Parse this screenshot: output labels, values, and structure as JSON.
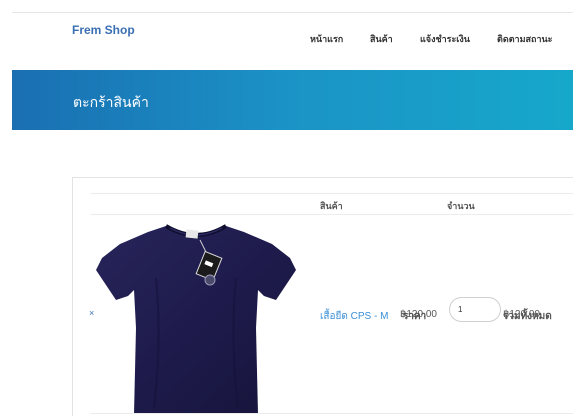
{
  "header": {
    "brand": "Frem Shop",
    "nav": [
      "หน้าแรก",
      "สินค้า",
      "แจ้งชำระเงิน",
      "ติดตามสถานะ"
    ]
  },
  "banner": {
    "title": "ตะกร้าสินค้า",
    "colors": [
      "#1a6fb2",
      "#16a8cb"
    ]
  },
  "cart": {
    "headers": {
      "product": "สินค้า",
      "price": "ราคา",
      "quantity": "จำนวน",
      "total": "รวมทั้งหมด"
    },
    "items": [
      {
        "remove": "×",
        "image": "navy-tshirt",
        "name": "เสื้อยืด CPS - M",
        "price": "฿120.00",
        "quantity": "1",
        "total": "฿120.00"
      }
    ]
  },
  "colors": {
    "accent": "#3a8fd6",
    "brand": "#3a6fb3"
  }
}
